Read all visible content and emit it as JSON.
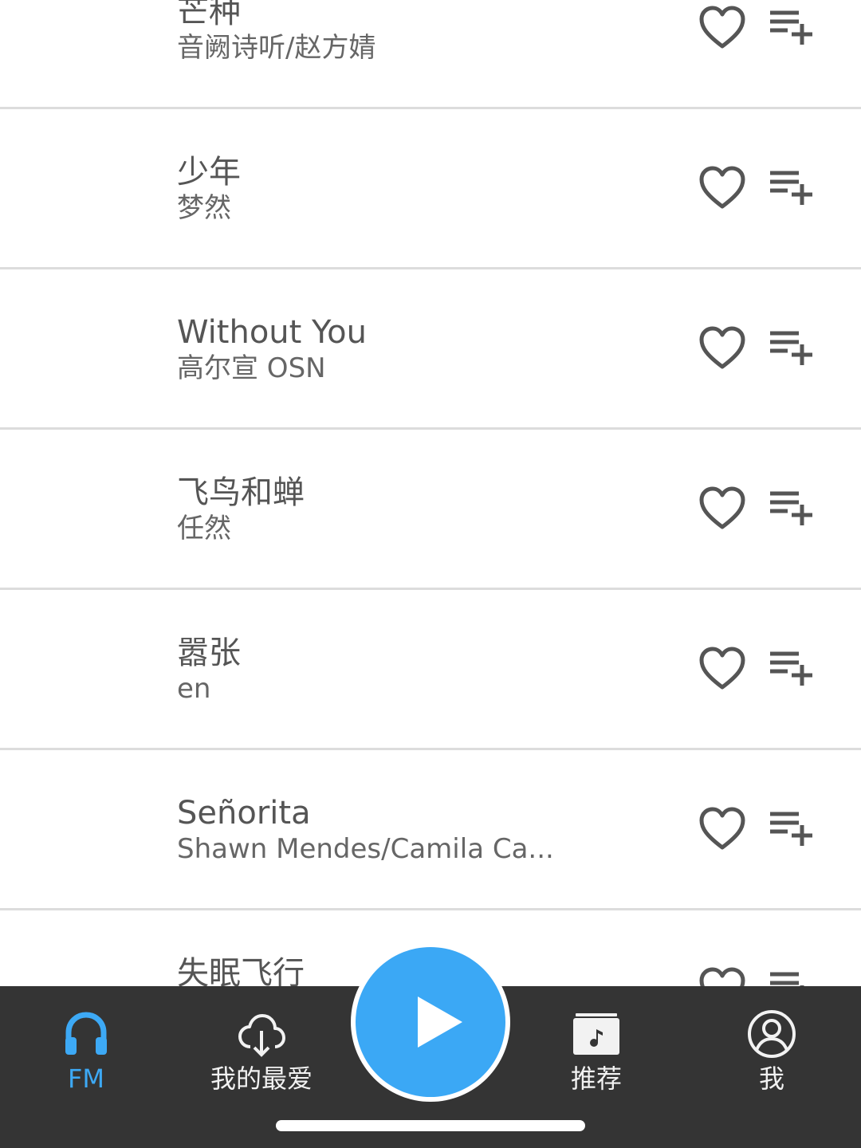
{
  "songs": [
    {
      "title": "芒种",
      "artist": "音阙诗听/赵方婧"
    },
    {
      "title": "少年",
      "artist": "梦然"
    },
    {
      "title": "Without You",
      "artist": "高尔宣 OSN"
    },
    {
      "title": "飞鸟和蝉",
      "artist": "任然"
    },
    {
      "title": "嚣张",
      "artist": "en"
    },
    {
      "title": "Señorita",
      "artist": "Shawn Mendes/Camila Ca..."
    },
    {
      "title": "失眠飞行",
      "artist": ""
    }
  ],
  "tabs": {
    "fm": {
      "label": "FM",
      "icon": "headphones-icon"
    },
    "favorites": {
      "label": "我的最爱",
      "icon": "cloud-download-icon"
    },
    "recommend": {
      "label": "推荐",
      "icon": "music-album-icon"
    },
    "me": {
      "label": "我",
      "icon": "user-circle-icon"
    }
  },
  "colors": {
    "accent": "#3ba8f5",
    "tab_bar": "#343434",
    "icon": "#555555"
  }
}
